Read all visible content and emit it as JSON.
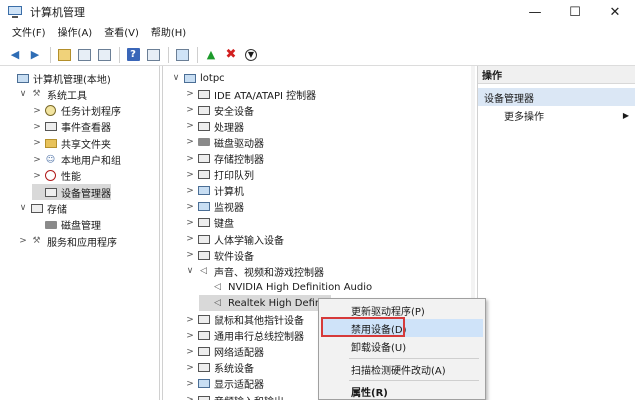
{
  "window": {
    "title": "计算机管理"
  },
  "menu": [
    "文件(F)",
    "操作(A)",
    "查看(V)",
    "帮助(H)"
  ],
  "left_tree": [
    {
      "label": "计算机管理(本地)",
      "level": 0,
      "chev": "",
      "icon": "computer-management-icon"
    },
    {
      "label": "系统工具",
      "level": 1,
      "chev": "∨",
      "icon": "tools-icon"
    },
    {
      "label": "任务计划程序",
      "level": 2,
      "chev": ">",
      "icon": "clock-icon"
    },
    {
      "label": "事件查看器",
      "level": 2,
      "chev": ">",
      "icon": "event-viewer-icon"
    },
    {
      "label": "共享文件夹",
      "level": 2,
      "chev": ">",
      "icon": "shared-folder-icon"
    },
    {
      "label": "本地用户和组",
      "level": 2,
      "chev": ">",
      "icon": "users-icon"
    },
    {
      "label": "性能",
      "level": 2,
      "chev": ">",
      "icon": "performance-icon"
    },
    {
      "label": "设备管理器",
      "level": 2,
      "chev": "",
      "icon": "device-manager-icon"
    },
    {
      "label": "存储",
      "level": 1,
      "chev": "∨",
      "icon": "storage-icon"
    },
    {
      "label": "磁盘管理",
      "level": 2,
      "chev": "",
      "icon": "disk-icon"
    },
    {
      "label": "服务和应用程序",
      "level": 1,
      "chev": ">",
      "icon": "services-icon"
    }
  ],
  "device_tree": [
    {
      "label": "lotpc",
      "level": 0,
      "chev": "∨",
      "icon": "computer-icon"
    },
    {
      "label": "IDE ATA/ATAPI 控制器",
      "level": 1,
      "chev": ">",
      "icon": "ide-icon"
    },
    {
      "label": "安全设备",
      "level": 1,
      "chev": ">",
      "icon": "security-icon"
    },
    {
      "label": "处理器",
      "level": 1,
      "chev": ">",
      "icon": "cpu-icon"
    },
    {
      "label": "磁盘驱动器",
      "level": 1,
      "chev": ">",
      "icon": "disk-drive-icon"
    },
    {
      "label": "存储控制器",
      "level": 1,
      "chev": ">",
      "icon": "storage-controller-icon"
    },
    {
      "label": "打印队列",
      "level": 1,
      "chev": ">",
      "icon": "printer-icon"
    },
    {
      "label": "计算机",
      "level": 1,
      "chev": ">",
      "icon": "computer-icon"
    },
    {
      "label": "监视器",
      "level": 1,
      "chev": ">",
      "icon": "monitor-icon"
    },
    {
      "label": "键盘",
      "level": 1,
      "chev": ">",
      "icon": "keyboard-icon"
    },
    {
      "label": "人体学输入设备",
      "level": 1,
      "chev": ">",
      "icon": "hid-icon"
    },
    {
      "label": "软件设备",
      "level": 1,
      "chev": ">",
      "icon": "software-device-icon"
    },
    {
      "label": "声音、视频和游戏控制器",
      "level": 1,
      "chev": "∨",
      "icon": "speaker-icon"
    },
    {
      "label": "NVIDIA High Definition Audio",
      "level": 2,
      "chev": "",
      "icon": "speaker-icon"
    },
    {
      "label": "Realtek High Definiti",
      "level": 2,
      "chev": "",
      "icon": "speaker-icon"
    },
    {
      "label": "鼠标和其他指针设备",
      "level": 1,
      "chev": ">",
      "icon": "mouse-icon"
    },
    {
      "label": "通用串行总线控制器",
      "level": 1,
      "chev": ">",
      "icon": "usb-icon"
    },
    {
      "label": "网络适配器",
      "level": 1,
      "chev": ">",
      "icon": "network-icon"
    },
    {
      "label": "系统设备",
      "level": 1,
      "chev": ">",
      "icon": "system-device-icon"
    },
    {
      "label": "显示适配器",
      "level": 1,
      "chev": ">",
      "icon": "display-adapter-icon"
    },
    {
      "label": "音频输入和输出",
      "level": 1,
      "chev": ">",
      "icon": "audio-io-icon"
    }
  ],
  "actions": {
    "header": "操作",
    "section": "设备管理器",
    "more": "更多操作"
  },
  "context_menu": [
    {
      "label": "更新驱动程序(P)"
    },
    {
      "label": "禁用设备(D)"
    },
    {
      "label": "卸载设备(U)"
    },
    {
      "label": "扫描检测硬件改动(A)"
    },
    {
      "label": "属性(R)"
    }
  ]
}
